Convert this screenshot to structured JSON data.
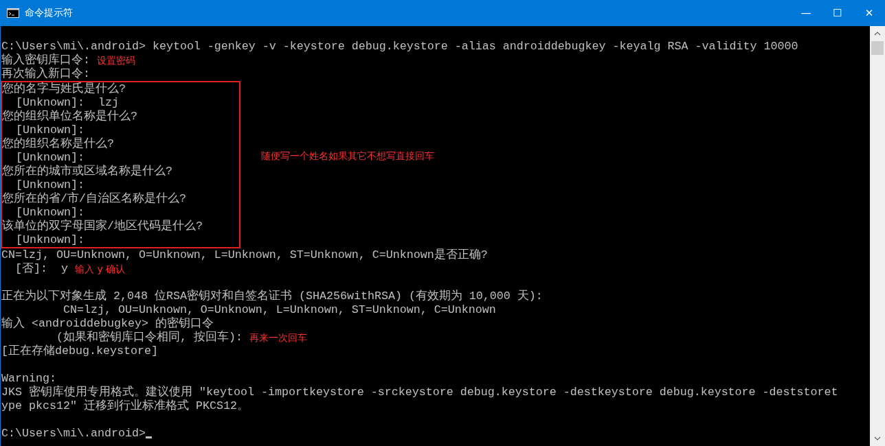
{
  "window": {
    "title": "命令提示符",
    "controls": [
      "—",
      "☐",
      "✕"
    ]
  },
  "console": {
    "before": [
      {
        "text": "C:\\Users\\mi\\.android> keytool -genkey -v -keystore debug.keystore -alias androiddebugkey -keyalg RSA -validity 10000"
      },
      {
        "text": "输入密钥库口令:",
        "note": "设置密码"
      },
      {
        "text": "再次输入新口令:"
      }
    ],
    "highlight": {
      "lines": [
        "您的名字与姓氏是什么?",
        "  [Unknown]:  lzj",
        "您的组织单位名称是什么?",
        "  [Unknown]:",
        "您的组织名称是什么?",
        "  [Unknown]:",
        "您所在的城市或区域名称是什么?",
        "  [Unknown]:",
        "您所在的省/市/自治区名称是什么?",
        "  [Unknown]:",
        "该单位的双字母国家/地区代码是什么?",
        "  [Unknown]:"
      ],
      "note": "随便写一个姓名如果其它不想写直接回车"
    },
    "after": [
      {
        "text": "CN=lzj, OU=Unknown, O=Unknown, L=Unknown, ST=Unknown, C=Unknown是否正确?"
      },
      {
        "text": "  [否]:  y",
        "note": "输入 y 确认"
      },
      {
        "blank_before": true,
        "text": "正在为以下对象生成 2,048 位RSA密钥对和自签名证书 (SHA256withRSA) (有效期为 10,000 天):"
      },
      {
        "text": "         CN=lzj, OU=Unknown, O=Unknown, L=Unknown, ST=Unknown, C=Unknown"
      },
      {
        "text": "输入 <androiddebugkey> 的密钥口令"
      },
      {
        "text": "        (如果和密钥库口令相同, 按回车):",
        "note": "再来一次回车"
      },
      {
        "text": "[正在存储debug.keystore]"
      },
      {
        "blank_before": true,
        "text": "Warning:"
      },
      {
        "text": "JKS 密钥库使用专用格式。建议使用 \"keytool -importkeystore -srckeystore debug.keystore -destkeystore debug.keystore -deststoret"
      },
      {
        "text": "ype pkcs12\" 迁移到行业标准格式 PKCS12。"
      },
      {
        "blank_before": true,
        "text": "C:\\Users\\mi\\.android>",
        "cursor": true
      }
    ]
  }
}
